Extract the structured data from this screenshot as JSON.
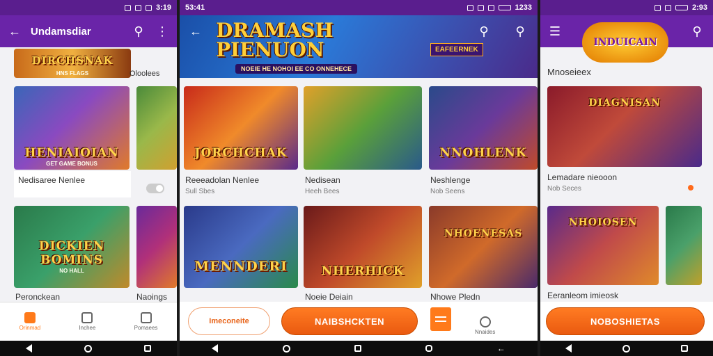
{
  "phone1": {
    "status_time": "3:19",
    "title": "Undamsdiar",
    "section_label": "Oloolees",
    "top_banner_caption": "DIRCHSNAK",
    "top_banner_sub": "HNS FLAGS",
    "games": [
      {
        "caption": "HENIAIOIAN",
        "sub": "GET GAME BONUS",
        "name": "Nedisaree Nenlee",
        "meta": ""
      },
      {
        "caption": "",
        "sub": "",
        "name": "",
        "meta": ""
      },
      {
        "caption": "DICKIEN BOMINS",
        "sub": "NO HALL",
        "name": "Peronckean",
        "meta": ""
      },
      {
        "caption": "",
        "sub": "",
        "name": "Naoings",
        "meta": ""
      }
    ],
    "nav": [
      {
        "label": "Orinmad",
        "icon": "home-icon"
      },
      {
        "label": "Inchee",
        "icon": "house-icon"
      },
      {
        "label": "Pomaees",
        "icon": "bookmark-icon"
      }
    ],
    "colors": {
      "appbar": "#6a24a8",
      "accent": "#ff7a1a"
    }
  },
  "phone2": {
    "status_time": "53:41",
    "status_time_right": "1233",
    "banner_title_line1": "DRAMASH",
    "banner_title_line2": "PIENUON",
    "banner_sub": "NOEIE HE NOHOI EE CO ONNEHECE",
    "banner_chip": "EAFEERNEK",
    "games": [
      {
        "caption": "JORCHCHAK",
        "name": "Reeeadolan Nenlee",
        "meta": "Sull Sbes"
      },
      {
        "caption": "",
        "name": "Nedisean",
        "meta": "Heeh Bees"
      },
      {
        "caption": "NNOHLENK",
        "name": "Neshlenge",
        "meta": "Nob Seens"
      },
      {
        "caption": "MENNDERI",
        "name": "",
        "meta": ""
      },
      {
        "caption": "NHERHICK",
        "name": "Noeie Deiain",
        "meta": ""
      },
      {
        "caption": "NHOENESAS",
        "name": "Nhowe Pledn",
        "meta": ""
      }
    ],
    "cta_outline": "Imeconeite",
    "cta_main": "NAIBSHCKTEN",
    "nav_label": "Nnaides"
  },
  "phone3": {
    "status_time": "2:93",
    "logo_text": "INDUICAIN",
    "section_label": "Mnoseieex",
    "featured": {
      "caption": "DIAGNISAN",
      "name": "Lemadare nieooon",
      "meta": "Nob Seces"
    },
    "second": {
      "caption": "NHOIOSEN",
      "name": "Eeranleom imieosk"
    },
    "cta_main": "NOBOSHIETAS"
  }
}
